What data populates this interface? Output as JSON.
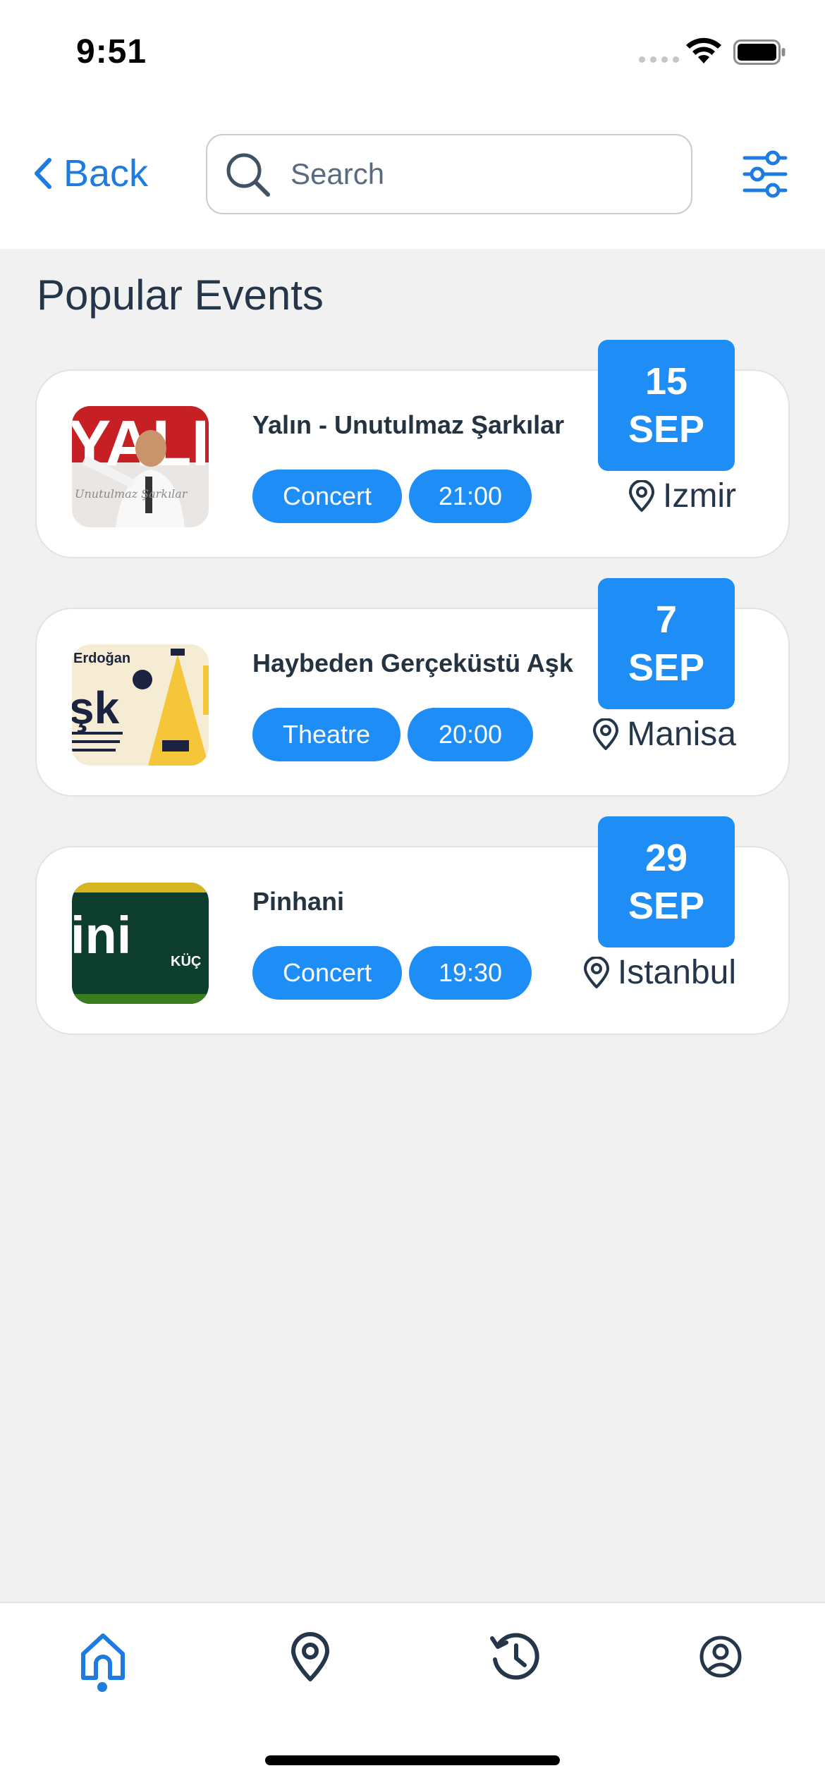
{
  "status_bar": {
    "time": "9:51"
  },
  "header": {
    "back_label": "Back",
    "search_placeholder": "Search"
  },
  "section_title": "Popular Events",
  "events": [
    {
      "title": "Yalın - Unutulmaz Şarkılar",
      "category": "Concert",
      "time": "21:00",
      "day": "15",
      "month": "SEP",
      "location": "Izmir",
      "thumb_text": "YALIN",
      "thumb_script": "Unutulmaz Şarkılar"
    },
    {
      "title": "Haybeden Gerçeküstü Aşk",
      "category": "Theatre",
      "time": "20:00",
      "day": "7",
      "month": "SEP",
      "location": "Manisa",
      "thumb_text": "Erdoğan",
      "thumb_text2": "şk"
    },
    {
      "title": "Pinhani",
      "category": "Concert",
      "time": "19:30",
      "day": "29",
      "month": "SEP",
      "location": "Istanbul",
      "thumb_text": "ini",
      "thumb_text2": "KÜÇ"
    }
  ],
  "tabs": [
    {
      "name": "home",
      "icon": "home-icon",
      "active": true
    },
    {
      "name": "map",
      "icon": "map-pin-icon",
      "active": false
    },
    {
      "name": "history",
      "icon": "history-icon",
      "active": false
    },
    {
      "name": "profile",
      "icon": "profile-icon",
      "active": false
    }
  ],
  "colors": {
    "accent": "#1e8ef6",
    "link": "#1e7be0",
    "background": "#f1f1f1",
    "text": "#26364a"
  }
}
